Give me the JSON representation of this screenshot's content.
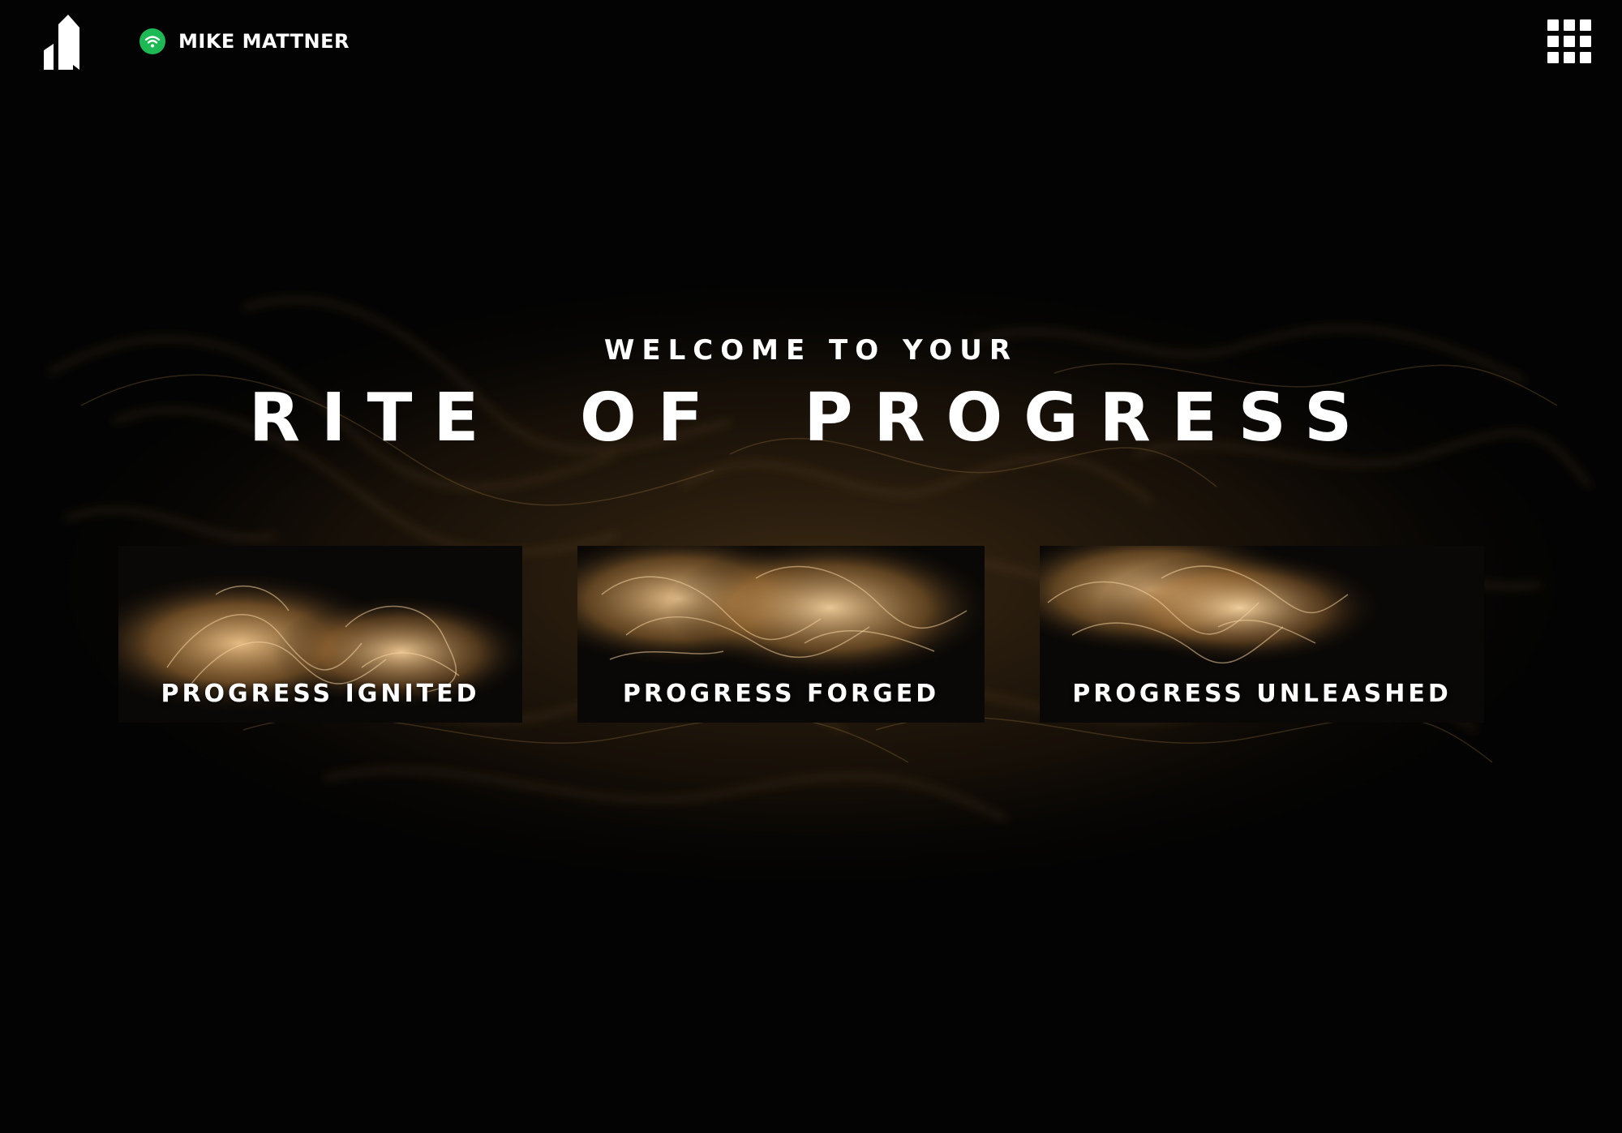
{
  "header": {
    "user_name": "MIKE MATTNER",
    "status_color": "#1db954",
    "logo_icon": "brand-logo-icon",
    "menu_icon": "grid-menu-icon"
  },
  "hero": {
    "welcome": "WELCOME TO YOUR",
    "title_words": [
      "RITE",
      "OF",
      "PROGRESS"
    ]
  },
  "cards": [
    {
      "label": "PROGRESS IGNITED"
    },
    {
      "label": "PROGRESS FORGED"
    },
    {
      "label": "PROGRESS UNLEASHED"
    }
  ],
  "colors": {
    "background": "#030303",
    "accent_gold": "#d9a86a",
    "text": "#ffffff"
  }
}
